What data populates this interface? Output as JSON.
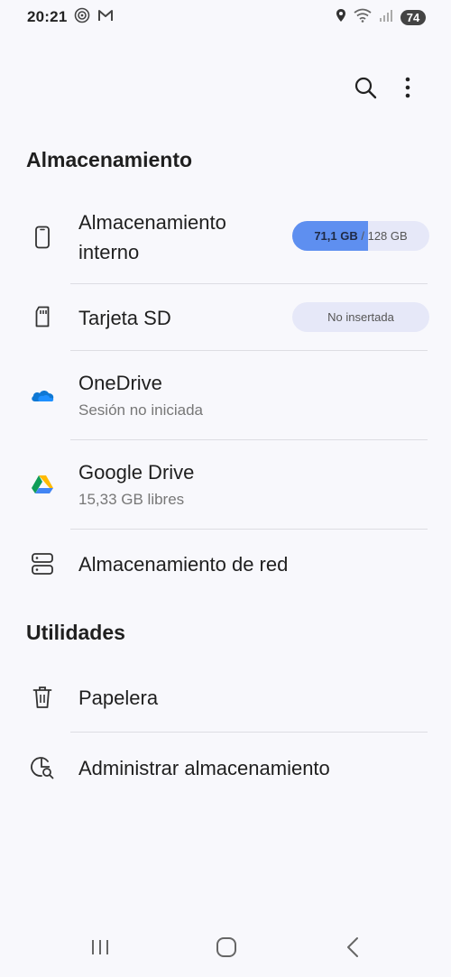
{
  "status_bar": {
    "time": "20:21",
    "battery": "74"
  },
  "toolbar": {
    "search_icon": "search-icon",
    "more_icon": "more-vert-icon"
  },
  "sections": {
    "storage_title": "Almacenamiento",
    "utilities_title": "Utilidades"
  },
  "storage_items": {
    "internal": {
      "title_line1": "Almacenamiento",
      "title_line2": "interno",
      "used": "71,1 GB",
      "sep_total": " / 128 GB",
      "used_fraction": 0.555
    },
    "sd": {
      "title": "Tarjeta SD",
      "status": "No insertada"
    },
    "onedrive": {
      "title": "OneDrive",
      "subtitle": "Sesión no iniciada"
    },
    "gdrive": {
      "title": "Google Drive",
      "subtitle": "15,33 GB libres"
    },
    "network": {
      "title": "Almacenamiento de red"
    }
  },
  "utility_items": {
    "trash": {
      "title": "Papelera"
    },
    "manage": {
      "title": "Administrar almacenamiento"
    }
  },
  "colors": {
    "accent": "#5e8ff0",
    "pill_bg": "#e6e8f8",
    "background": "#f8f8fc"
  }
}
